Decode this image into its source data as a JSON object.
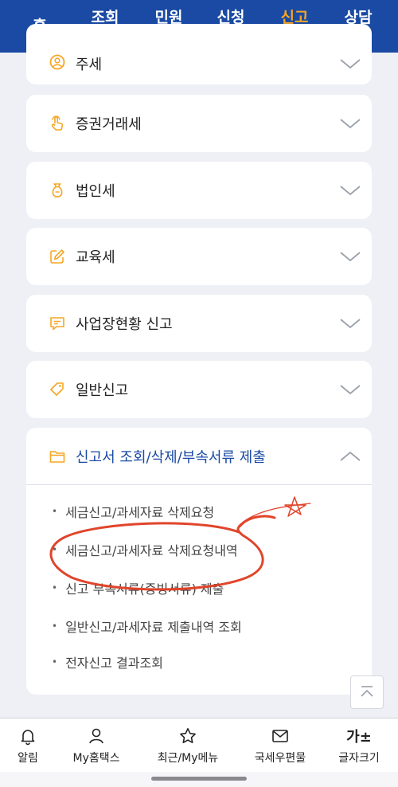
{
  "nav": {
    "items": [
      {
        "label": "홈"
      },
      {
        "label": "조회\n발급"
      },
      {
        "label": "민원\n증명"
      },
      {
        "label": "신청\n제출"
      },
      {
        "label": "신고\n납부",
        "active": true
      },
      {
        "label": "상담\n제보"
      }
    ],
    "active_color": "#f5a623",
    "bg_color": "#1a4aa3"
  },
  "sections": [
    {
      "label": "주세",
      "icon": "user-circle-icon"
    },
    {
      "label": "증권거래세",
      "icon": "hand-tap-icon"
    },
    {
      "label": "법인세",
      "icon": "money-bag-icon"
    },
    {
      "label": "교육세",
      "icon": "edit-icon"
    },
    {
      "label": "사업장현황 신고",
      "icon": "message-icon"
    },
    {
      "label": "일반신고",
      "icon": "tag-icon"
    },
    {
      "label": "신고서 조회/삭제/부속서류 제출",
      "icon": "folder-icon",
      "expanded": true
    }
  ],
  "subitems": [
    "세금신고/과세자료 삭제요청",
    "세금신고/과세자료 삭제요청내역",
    "신고 부속서류(증빙서류) 제출",
    "일반신고/과세자료 제출내역 조회",
    "전자신고 결과조회"
  ],
  "bottom": {
    "items": [
      {
        "label": "알림",
        "icon": "bell-icon"
      },
      {
        "label": "My홈택스",
        "icon": "person-icon"
      },
      {
        "label": "최근/My메뉴",
        "icon": "star-icon"
      },
      {
        "label": "국세우편물",
        "icon": "mail-icon"
      },
      {
        "label": "글자크기",
        "icon": "font-size-icon"
      }
    ],
    "font_size_glyph": "가±"
  },
  "colors": {
    "accent_orange": "#f5a623",
    "brand_blue": "#1a4aa3",
    "annotation_red": "#e0452b"
  }
}
